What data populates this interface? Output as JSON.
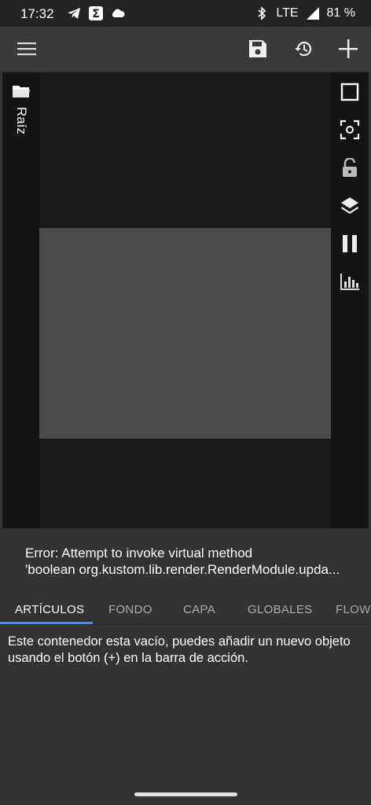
{
  "status_bar": {
    "time": "17:32",
    "network": "LTE",
    "battery": "81 %",
    "icons": [
      "telegram-icon",
      "sigma-app-icon",
      "cloud-icon",
      "bluetooth-icon",
      "signal-icon",
      "battery-icon"
    ]
  },
  "toolbar": {
    "icons": [
      "menu-icon",
      "save-icon",
      "history-icon",
      "add-icon"
    ]
  },
  "preview": {
    "folder_label": "Raíz",
    "right_tools": [
      "square-outline-icon",
      "focus-icon",
      "lock-icon",
      "layers-icon",
      "pause-icon",
      "bar-chart-icon"
    ]
  },
  "error": {
    "line1": "Error: Attempt to invoke virtual method",
    "line2": "'boolean org.kustom.lib.render.RenderModule.upda..."
  },
  "tabs": [
    {
      "label": "ARTÍCULOS",
      "active": true
    },
    {
      "label": "FONDO",
      "active": false
    },
    {
      "label": "CAPA",
      "active": false
    },
    {
      "label": "GLOBALES",
      "active": false
    },
    {
      "label": "FLOWS",
      "active": false
    }
  ],
  "content": {
    "empty_message": "Este contenedor esta vacío, puedes añadir un nuevo objeto usando el botón (+) en la barra de acción."
  },
  "colors": {
    "accent": "#4a90d9",
    "toolbar_bg": "#3a3a3a",
    "canvas": "#4a4a4a"
  }
}
